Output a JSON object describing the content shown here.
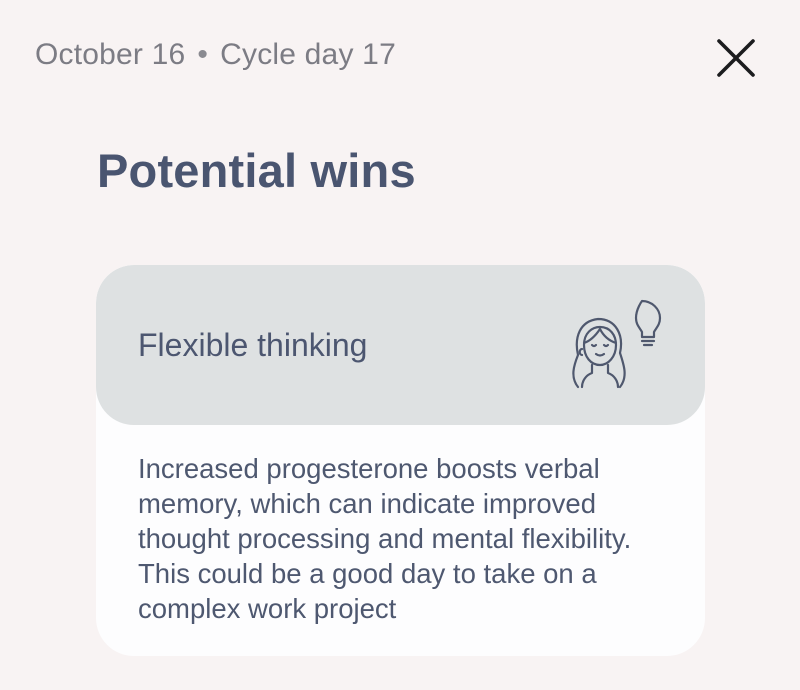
{
  "header": {
    "date": "October 16",
    "separator": "•",
    "cycle_day": "Cycle day 17",
    "close_icon": "close-icon"
  },
  "page": {
    "title": "Potential wins"
  },
  "card": {
    "title": "Flexible thinking",
    "icon": "woman-lightbulb-icon",
    "description": "Increased progesterone boosts verbal memory, which can indicate improved thought processing and mental flexibility. This could be a good day to take on a complex work project"
  },
  "colors": {
    "background": "#f8f3f3",
    "card_header": "#dee1e2",
    "card_body": "#fdfdfe",
    "title_text": "#4a5570",
    "muted_text": "#7c7c84"
  }
}
